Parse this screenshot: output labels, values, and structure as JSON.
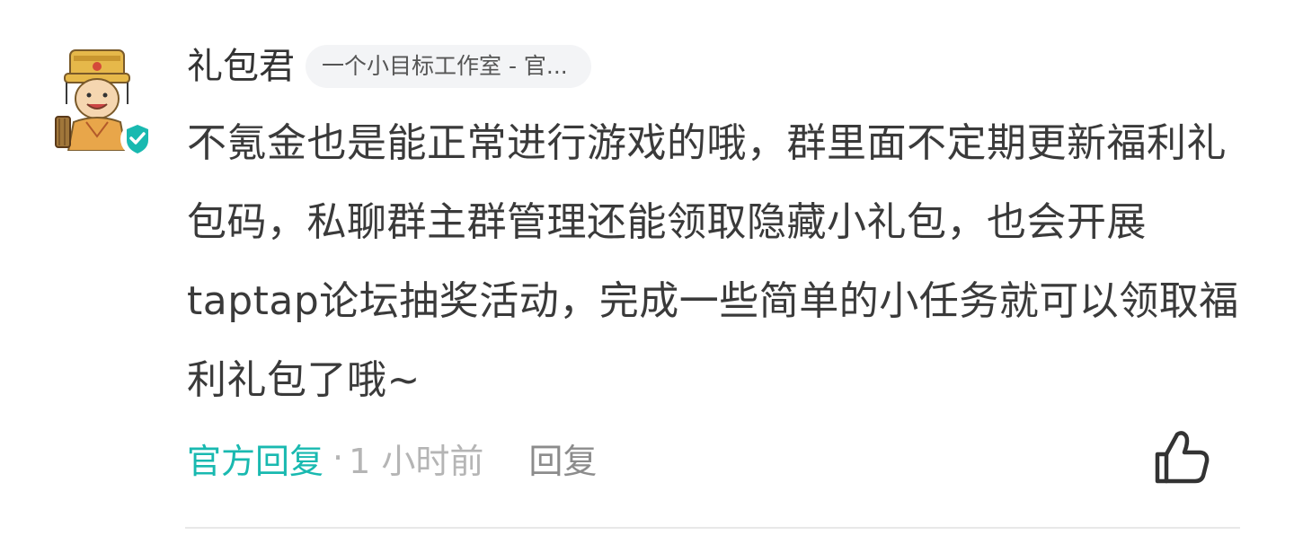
{
  "comment": {
    "username": "礼包君",
    "studio_badge": "一个小目标工作室 - 官...",
    "body": "不氪金也是能正常进行游戏的哦，群里面不定期更新福利礼包码，私聊群主群管理还能领取隐藏小礼包，也会开展taptap论坛抽奖活动，完成一些简单的小任务就可以领取福利礼包了哦~",
    "official_reply_label": "官方回复",
    "separator": "·",
    "time": "1 小时前",
    "reply_label": "回复"
  },
  "icons": {
    "avatar": "cartoon-official-avatar",
    "verified": "verified-check-icon",
    "like": "thumbs-up-icon"
  },
  "colors": {
    "accent": "#19b9b0",
    "text": "#3a3a3a",
    "muted": "#b5b5b5",
    "badge_bg": "#f3f4f6"
  }
}
